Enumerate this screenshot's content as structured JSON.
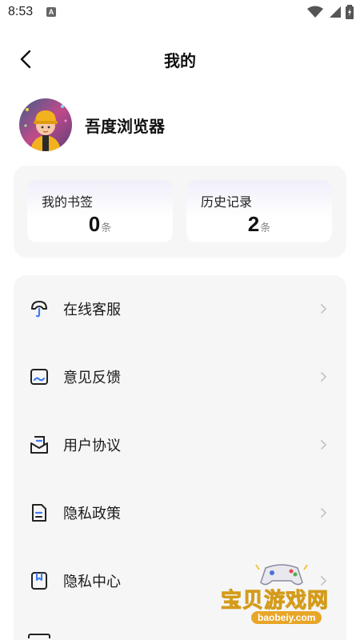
{
  "status_bar": {
    "time": "8:53",
    "notification_badge": "A"
  },
  "header": {
    "title": "我的"
  },
  "profile": {
    "name": "吾度浏览器"
  },
  "stats": [
    {
      "label": "我的书签",
      "value": "0",
      "unit": "条"
    },
    {
      "label": "历史记录",
      "value": "2",
      "unit": "条"
    }
  ],
  "menu": [
    {
      "label": "在线客服",
      "icon": "customer-service-icon"
    },
    {
      "label": "意见反馈",
      "icon": "feedback-icon"
    },
    {
      "label": "用户协议",
      "icon": "user-agreement-icon"
    },
    {
      "label": "隐私政策",
      "icon": "privacy-policy-icon"
    },
    {
      "label": "隐私中心",
      "icon": "privacy-center-icon"
    }
  ],
  "watermark": {
    "text": "宝贝游戏网",
    "url": "baobeiy.com"
  },
  "colors": {
    "accent_blue": "#3d7cf2",
    "icon_dark": "#222222",
    "card_bg": "#f6f6f7"
  }
}
